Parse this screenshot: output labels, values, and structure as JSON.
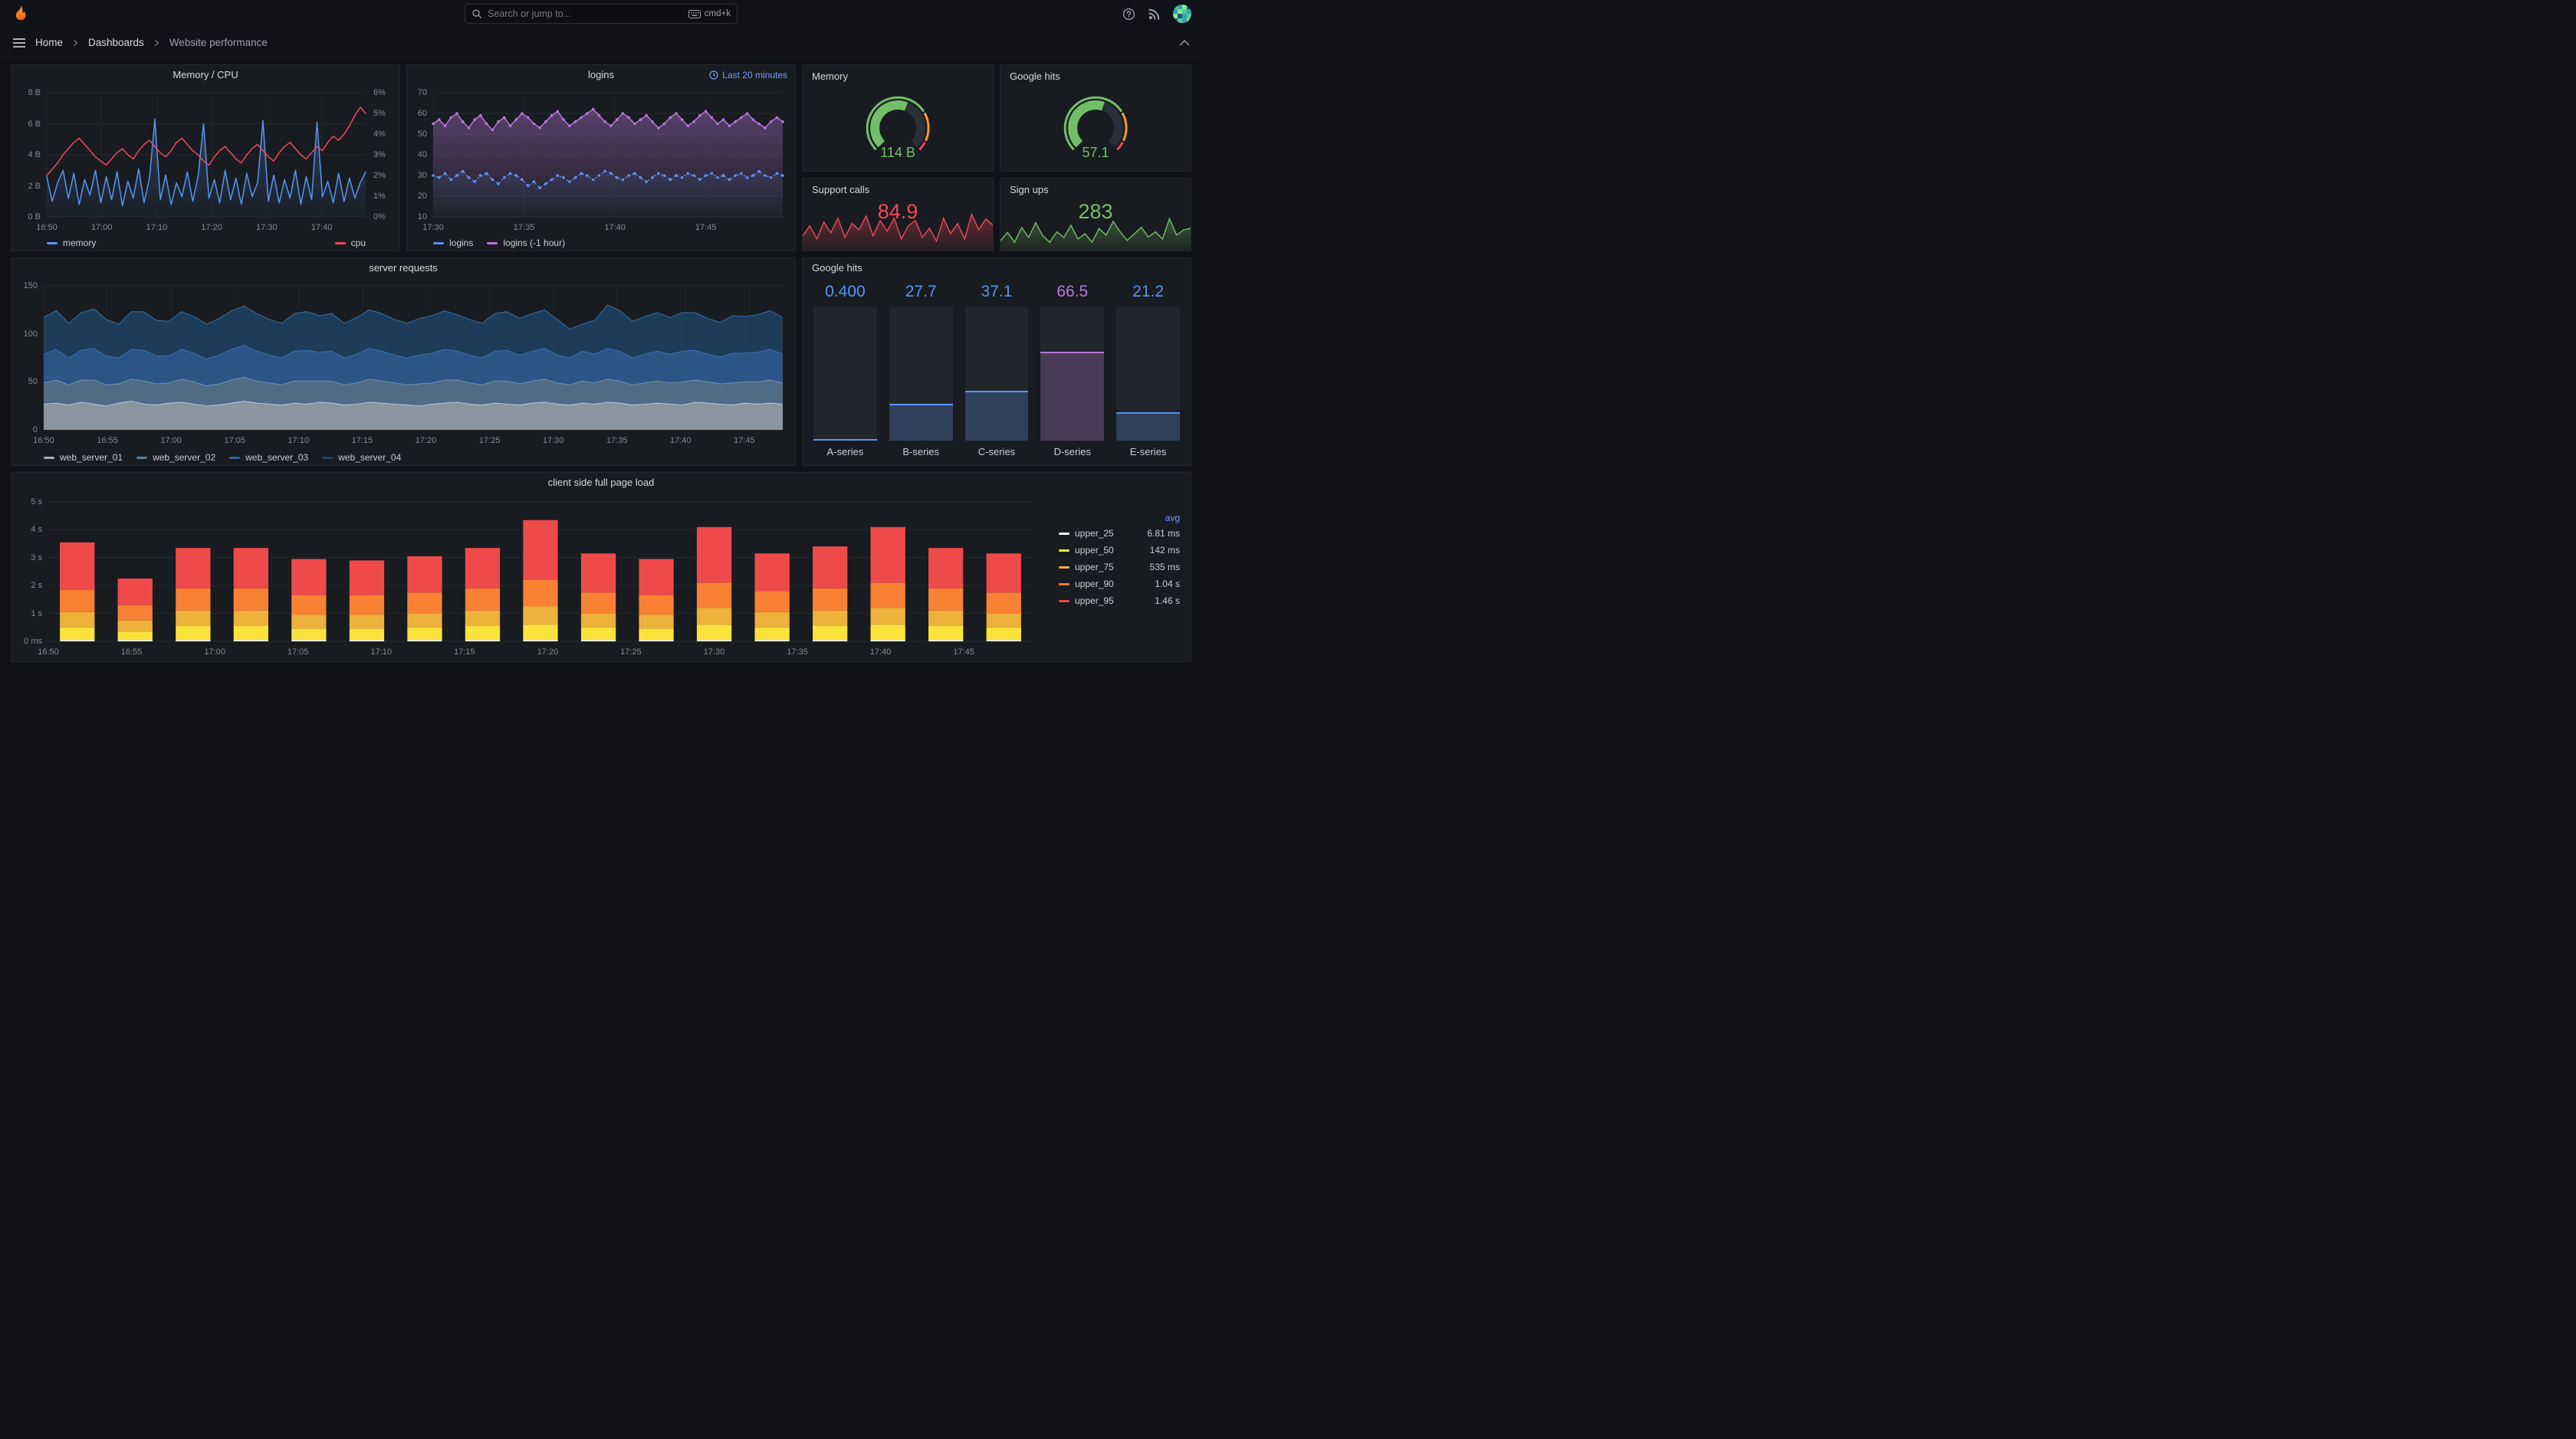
{
  "colors": {
    "blue": "#5794f2",
    "red": "#f2495c",
    "green": "#73bf69",
    "purple": "#b877d9",
    "orange": "#ff9830",
    "yellow": "#fade2a",
    "link": "#6e9fff"
  },
  "topbar": {
    "search_placeholder": "Search or jump to...",
    "shortcut_label": "cmd+k"
  },
  "breadcrumb": {
    "items": [
      "Home",
      "Dashboards",
      "Website performance"
    ]
  },
  "stats": {
    "memory_gauge": {
      "title": "Memory",
      "value": "114 B",
      "fraction": 0.58,
      "color": "#73bf69",
      "thresholds": [
        {
          "to": 0.72,
          "color": "#73bf69"
        },
        {
          "to": 0.93,
          "color": "#ff9830"
        },
        {
          "to": 1,
          "color": "#f2495c"
        }
      ]
    },
    "google_gauge": {
      "title": "Google hits",
      "value": "57.1",
      "fraction": 0.571,
      "color": "#73bf69",
      "thresholds": [
        {
          "to": 0.72,
          "color": "#73bf69"
        },
        {
          "to": 0.93,
          "color": "#ff9830"
        },
        {
          "to": 1,
          "color": "#f2495c"
        }
      ]
    },
    "support_calls": {
      "title": "Support calls",
      "value": "84.9",
      "color": "#f2495c",
      "spark": [
        62,
        75,
        58,
        80,
        66,
        85,
        60,
        78,
        70,
        88,
        62,
        82,
        68,
        85,
        58,
        75,
        82,
        60,
        72,
        55,
        85,
        65,
        78,
        58,
        90,
        70,
        84,
        76
      ]
    },
    "sign_ups": {
      "title": "Sign ups",
      "value": "283",
      "color": "#73bf69",
      "spark": [
        245,
        270,
        240,
        285,
        255,
        300,
        260,
        240,
        272,
        255,
        292,
        250,
        266,
        240,
        282,
        262,
        304,
        272,
        246,
        266,
        286,
        256,
        272,
        250,
        312,
        262,
        278,
        283
      ]
    }
  },
  "chart_data": [
    {
      "id": "memory_cpu",
      "type": "line",
      "title": "Memory / CPU",
      "x_ticks": [
        "16:50",
        "17:00",
        "17:10",
        "17:20",
        "17:30",
        "17:40"
      ],
      "x_span": 0.862,
      "left_axis": {
        "ticks": [
          "8 B",
          "6 B",
          "4 B",
          "2 B",
          "0 B"
        ],
        "min": 0,
        "max": 8
      },
      "right_axis": {
        "ticks": [
          "6%",
          "5%",
          "4%",
          "3%",
          "2%",
          "1%",
          "0%"
        ],
        "min": 0,
        "max": 6
      },
      "legend": "split",
      "series": [
        {
          "name": "memory",
          "color": "#5794f2",
          "fill_opacity": 0.3,
          "values": [
            2.6,
            1.0,
            2.2,
            3.0,
            1.2,
            2.8,
            0.8,
            2.4,
            1.4,
            3.0,
            0.9,
            2.6,
            1.1,
            2.9,
            0.7,
            2.3,
            1.2,
            3.1,
            0.9,
            2.5,
            6.3,
            1.1,
            2.7,
            0.8,
            2.2,
            1.3,
            2.9,
            1.0,
            2.6,
            6.0,
            1.2,
            2.4,
            0.9,
            3.0,
            1.1,
            2.5,
            0.8,
            2.8,
            1.3,
            2.2,
            6.2,
            1.0,
            2.7,
            0.9,
            2.4,
            1.2,
            3.0,
            0.8,
            2.6,
            1.1,
            6.1,
            1.3,
            2.3,
            0.9,
            2.8,
            1.0,
            2.5,
            1.2,
            2.2,
            2.9
          ]
        },
        {
          "name": "cpu",
          "color": "#f2495c",
          "axis": "right",
          "values": [
            2.0,
            2.3,
            2.6,
            3.0,
            3.3,
            3.6,
            3.8,
            3.5,
            3.2,
            2.9,
            2.7,
            2.5,
            2.8,
            3.1,
            3.3,
            3.0,
            2.8,
            3.2,
            3.5,
            3.7,
            3.4,
            3.1,
            2.9,
            3.2,
            3.6,
            3.8,
            3.5,
            3.2,
            3.0,
            2.7,
            2.5,
            2.9,
            3.2,
            3.4,
            3.1,
            2.8,
            2.6,
            3.0,
            3.3,
            3.5,
            3.2,
            2.9,
            2.7,
            3.1,
            3.4,
            3.6,
            3.3,
            3.0,
            2.8,
            3.1,
            3.4,
            3.2,
            3.6,
            3.9,
            3.7,
            4.0,
            4.4,
            4.9,
            5.3,
            5.0
          ]
        }
      ]
    },
    {
      "id": "logins",
      "type": "line",
      "title": "logins",
      "time_range_label": "Last 20 minutes",
      "x_ticks": [
        "17:30",
        "17:35",
        "17:40",
        "17:45"
      ],
      "x_span": 0.78,
      "left_axis": {
        "ticks": [
          "70",
          "60",
          "50",
          "40",
          "30",
          "20",
          "10"
        ],
        "min": 10,
        "max": 70
      },
      "legend": "row",
      "series": [
        {
          "name": "logins",
          "color": "#5794f2",
          "dash": "1 4",
          "points": true,
          "fill_opacity": 0.12,
          "values": [
            30,
            29,
            31,
            28,
            30,
            32,
            29,
            27,
            30,
            31,
            28,
            26,
            29,
            31,
            30,
            28,
            25,
            27,
            24,
            26,
            28,
            30,
            29,
            27,
            29,
            31,
            30,
            28,
            30,
            32,
            31,
            29,
            28,
            30,
            31,
            29,
            27,
            29,
            31,
            30,
            28,
            30,
            29,
            31,
            30,
            28,
            30,
            31,
            29,
            30,
            28,
            30,
            31,
            29,
            30,
            32,
            30,
            29,
            31,
            30
          ]
        },
        {
          "name": "logins (-1 hour)",
          "color": "#b877d9",
          "points": true,
          "fill_opacity": 0.4,
          "values": [
            55,
            57,
            54,
            58,
            60,
            56,
            53,
            57,
            59,
            55,
            52,
            56,
            58,
            54,
            57,
            60,
            58,
            55,
            53,
            56,
            59,
            61,
            57,
            54,
            56,
            58,
            60,
            62,
            59,
            56,
            54,
            57,
            60,
            58,
            55,
            57,
            59,
            56,
            53,
            55,
            58,
            60,
            57,
            54,
            56,
            59,
            61,
            58,
            55,
            57,
            54,
            56,
            58,
            60,
            57,
            55,
            53,
            56,
            58,
            56
          ]
        }
      ]
    },
    {
      "id": "server_requests",
      "type": "stacked_area",
      "title": "server requests",
      "x_ticks": [
        "16:50",
        "16:55",
        "17:00",
        "17:05",
        "17:10",
        "17:15",
        "17:20",
        "17:25",
        "17:30",
        "17:35",
        "17:40",
        "17:45"
      ],
      "x_span": 0.948,
      "left_axis": {
        "ticks": [
          "150",
          "100",
          "50",
          "0"
        ],
        "min": 0,
        "max": 150
      },
      "series": [
        {
          "name": "web_server_01",
          "color": "#a3b1bf",
          "edge": "#d9e0e8",
          "values": [
            27,
            28,
            26,
            29,
            27,
            25,
            28,
            30,
            27,
            26,
            28,
            29,
            27,
            25,
            26,
            28,
            30,
            28,
            27,
            26,
            28,
            27,
            29,
            28,
            26,
            27,
            29,
            28,
            27,
            26,
            25,
            27,
            28,
            29,
            27,
            26,
            28,
            27,
            26,
            28,
            29,
            27,
            26,
            28,
            27,
            29,
            28,
            26,
            27,
            28,
            27,
            26,
            29,
            28,
            27,
            26,
            28,
            27,
            28,
            27
          ]
        },
        {
          "name": "web_server_02",
          "color": "#5e7e9e",
          "edge": "#86a6c4",
          "values": [
            22,
            24,
            21,
            23,
            25,
            22,
            20,
            23,
            24,
            22,
            21,
            24,
            23,
            21,
            22,
            24,
            25,
            23,
            22,
            21,
            23,
            24,
            22,
            23,
            21,
            22,
            24,
            23,
            22,
            21,
            23,
            22,
            24,
            23,
            22,
            21,
            23,
            24,
            22,
            23,
            24,
            22,
            21,
            23,
            22,
            24,
            23,
            21,
            22,
            23,
            22,
            24,
            23,
            22,
            21,
            23,
            22,
            23,
            24,
            22
          ]
        },
        {
          "name": "web_server_03",
          "color": "#31619c",
          "edge": "#4a86cc",
          "values": [
            30,
            32,
            28,
            31,
            33,
            30,
            27,
            31,
            32,
            29,
            28,
            31,
            30,
            28,
            30,
            32,
            33,
            31,
            29,
            28,
            31,
            32,
            30,
            31,
            28,
            30,
            32,
            31,
            29,
            28,
            30,
            31,
            32,
            30,
            29,
            28,
            31,
            32,
            30,
            31,
            32,
            29,
            28,
            31,
            30,
            32,
            31,
            28,
            30,
            31,
            30,
            32,
            31,
            29,
            28,
            31,
            30,
            31,
            32,
            30
          ]
        },
        {
          "name": "web_server_04",
          "color": "#1f4468",
          "edge": "#356ba3",
          "values": [
            38,
            40,
            36,
            39,
            41,
            38,
            35,
            39,
            40,
            37,
            36,
            39,
            38,
            36,
            38,
            40,
            41,
            39,
            37,
            36,
            39,
            40,
            38,
            39,
            36,
            38,
            40,
            39,
            37,
            36,
            38,
            39,
            40,
            38,
            37,
            36,
            39,
            40,
            38,
            39,
            40,
            37,
            30,
            28,
            35,
            45,
            42,
            38,
            39,
            40,
            38,
            40,
            39,
            37,
            36,
            39,
            38,
            39,
            40,
            38
          ]
        }
      ]
    },
    {
      "id": "google_hits_bars",
      "type": "bar_gauge",
      "title": "Google hits",
      "max": 100,
      "bars": [
        {
          "label": "A-series",
          "value_text": "0.400",
          "value": 0.4,
          "color": "#5794f2"
        },
        {
          "label": "B-series",
          "value_text": "27.7",
          "value": 27.7,
          "color": "#5794f2"
        },
        {
          "label": "C-series",
          "value_text": "37.1",
          "value": 37.1,
          "color": "#5794f2"
        },
        {
          "label": "D-series",
          "value_text": "66.5",
          "value": 66.5,
          "color": "#b877d9"
        },
        {
          "label": "E-series",
          "value_text": "21.2",
          "value": 21.2,
          "color": "#5794f2"
        }
      ]
    },
    {
      "id": "page_load",
      "type": "stacked_bars",
      "title": "client side full page load",
      "x_ticks": [
        "16:50",
        "16:55",
        "17:00",
        "17:05",
        "17:10",
        "17:15",
        "17:20",
        "17:25",
        "17:30",
        "17:35",
        "17:40",
        "17:45"
      ],
      "x_span": 0.93,
      "left_axis": {
        "ticks": [
          "5 s",
          "4 s",
          "3 s",
          "2 s",
          "1 s",
          "0 ms"
        ],
        "min": 0,
        "max": 5
      },
      "series": [
        {
          "name": "upper_25",
          "color": "#ffffff",
          "values": [
            0.05,
            0.05,
            0.05,
            0.05,
            0.05,
            0.05,
            0.05,
            0.05,
            0.05,
            0.05,
            0.05,
            0.05,
            0.05,
            0.05,
            0.05,
            0.05,
            0.05
          ]
        },
        {
          "name": "upper_50",
          "color": "#fbe33b",
          "values": [
            0.45,
            0.3,
            0.5,
            0.5,
            0.4,
            0.4,
            0.45,
            0.5,
            0.55,
            0.45,
            0.4,
            0.55,
            0.45,
            0.5,
            0.55,
            0.5,
            0.45
          ]
        },
        {
          "name": "upper_75",
          "color": "#edb13c",
          "values": [
            0.55,
            0.4,
            0.55,
            0.55,
            0.5,
            0.5,
            0.5,
            0.55,
            0.65,
            0.5,
            0.5,
            0.6,
            0.55,
            0.55,
            0.6,
            0.55,
            0.5
          ]
        },
        {
          "name": "upper_90",
          "color": "#f98133",
          "values": [
            0.8,
            0.55,
            0.8,
            0.8,
            0.7,
            0.7,
            0.75,
            0.8,
            0.95,
            0.75,
            0.7,
            0.9,
            0.75,
            0.8,
            0.9,
            0.8,
            0.75
          ]
        },
        {
          "name": "upper_95",
          "color": "#ef4a4a",
          "values": [
            1.7,
            0.95,
            1.45,
            1.45,
            1.3,
            1.25,
            1.3,
            1.45,
            2.15,
            1.4,
            1.3,
            2.0,
            1.35,
            1.5,
            2.0,
            1.45,
            1.4
          ]
        }
      ],
      "legend": {
        "header": "avg",
        "rows": [
          {
            "name": "upper_25",
            "value": "6.81 ms",
            "color": "#ffffff"
          },
          {
            "name": "upper_50",
            "value": "142 ms",
            "color": "#fbe33b"
          },
          {
            "name": "upper_75",
            "value": "535 ms",
            "color": "#edb13c"
          },
          {
            "name": "upper_90",
            "value": "1.04 s",
            "color": "#f98133"
          },
          {
            "name": "upper_95",
            "value": "1.46 s",
            "color": "#ef4a4a"
          }
        ]
      }
    }
  ]
}
